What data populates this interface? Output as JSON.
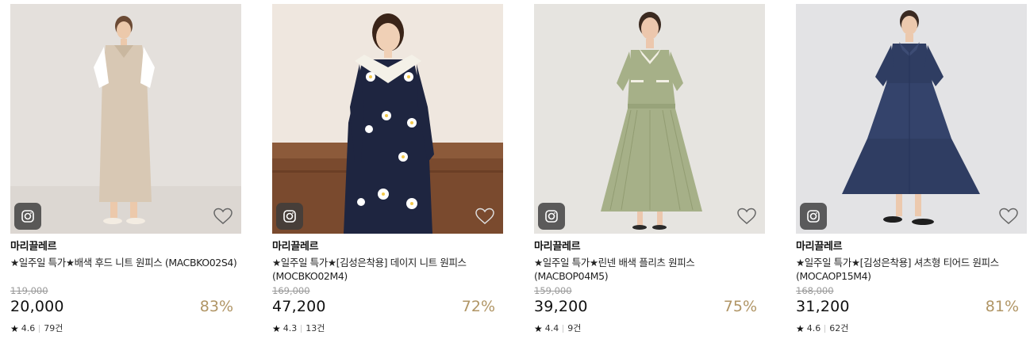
{
  "products": [
    {
      "brand": "마리끌레르",
      "title": "★일주일 특가★배색 후드 니트 원피스 (MACBKO02S4)",
      "original_price": "119,000",
      "price": "20,000",
      "discount": "83%",
      "rating": "4.6",
      "reviews": "79건",
      "star": "★",
      "colors": {
        "bg": "#e4e0dc",
        "dress": "#d8c8b4",
        "accent": "#ffffff"
      }
    },
    {
      "brand": "마리끌레르",
      "title": "★일주일 특가★[김성은착용] 데이지 니트 원피스 (MOCBKO02M4)",
      "original_price": "169,000",
      "price": "47,200",
      "discount": "72%",
      "rating": "4.3",
      "reviews": "13건",
      "star": "★",
      "colors": {
        "bg": "#efe7df",
        "dress": "#1e2540",
        "accent": "#ffffff"
      }
    },
    {
      "brand": "마리끌레르",
      "title": "★일주일 특가★린넨 배색 플리츠 원피스 (MACBOP04M5)",
      "original_price": "159,000",
      "price": "39,200",
      "discount": "75%",
      "rating": "4.4",
      "reviews": "9건",
      "star": "★",
      "colors": {
        "bg": "#e6e4e0",
        "dress": "#a6b088",
        "accent": "#f2efe4"
      }
    },
    {
      "brand": "마리끌레르",
      "title": "★일주일 특가★[김성은착용] 셔츠형 티어드 원피스 (MOCAOP15M4)",
      "original_price": "168,000",
      "price": "31,200",
      "discount": "81%",
      "rating": "4.6",
      "reviews": "62건",
      "star": "★",
      "colors": {
        "bg": "#e3e3e5",
        "dress": "#2f3d62",
        "accent": "#2f3d62"
      }
    }
  ],
  "icons": {
    "camera": "camera-icon",
    "wishlist": "heart-icon"
  },
  "theme": {
    "discount_color": "#b09565"
  }
}
